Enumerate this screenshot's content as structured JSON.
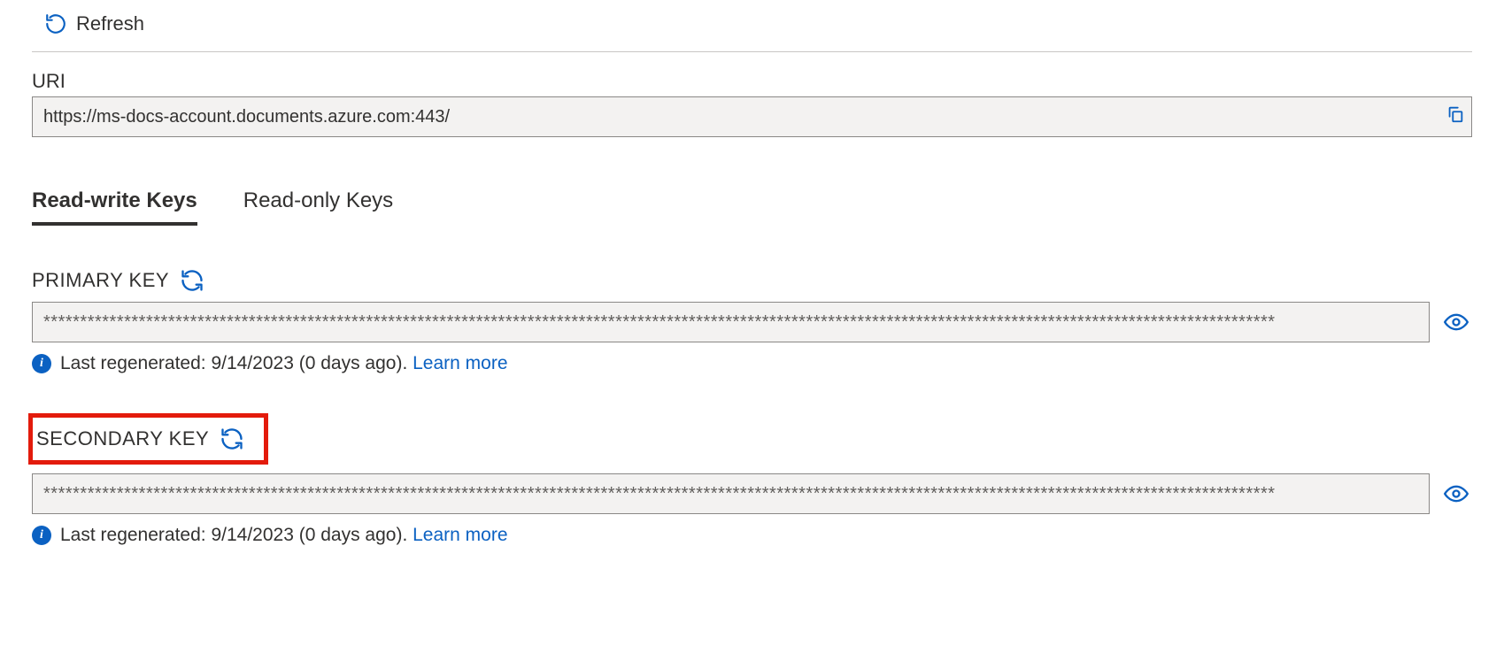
{
  "toolbar": {
    "refresh_label": "Refresh"
  },
  "uri": {
    "label": "URI",
    "value": "https://ms-docs-account.documents.azure.com:443/"
  },
  "tabs": {
    "read_write": "Read-write Keys",
    "read_only": "Read-only Keys"
  },
  "primary_key": {
    "label": "PRIMARY KEY",
    "masked_value": "************************************************************************************************************************************************************************",
    "info_text": "Last regenerated: 9/14/2023 (0 days ago). ",
    "learn_more": "Learn more"
  },
  "secondary_key": {
    "label": "SECONDARY KEY",
    "masked_value": "************************************************************************************************************************************************************************",
    "info_text": "Last regenerated: 9/14/2023 (0 days ago). ",
    "learn_more": "Learn more"
  },
  "colors": {
    "link": "#0b61c2",
    "highlight": "#e31b0c"
  }
}
